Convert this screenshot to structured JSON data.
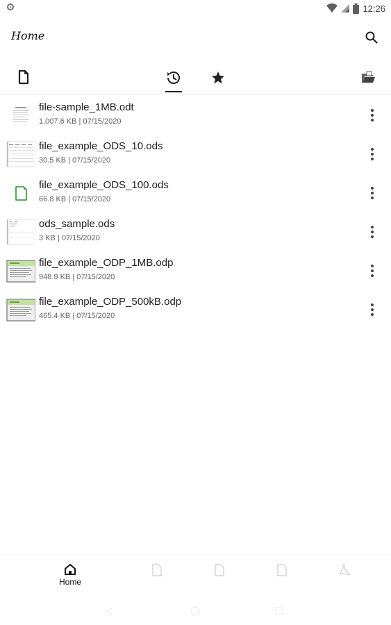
{
  "status_bar": {
    "time": "12:26"
  },
  "app_bar": {
    "title": "Home"
  },
  "tabs": [
    {
      "icon": "document-icon"
    },
    {
      "icon": "recent-history-icon",
      "selected": true
    },
    {
      "icon": "star-icon"
    },
    {
      "icon": "open-folder-icon"
    }
  ],
  "files": [
    {
      "name": "file-sample_1MB.odt",
      "meta": "1,007.6 KB | 07/15/2020",
      "thumb": "text-document-thumbnail"
    },
    {
      "name": "file_example_ODS_10.ods",
      "meta": "30.5 KB | 07/15/2020",
      "thumb": "spreadsheet-thumbnail"
    },
    {
      "name": "file_example_ODS_100.ods",
      "meta": "66.8 KB | 07/15/2020",
      "thumb": "spreadsheet-file-icon"
    },
    {
      "name": "ods_sample.ods",
      "meta": "3 KB | 07/15/2020",
      "thumb": "spreadsheet-thumbnail"
    },
    {
      "name": "file_example_ODP_1MB.odp",
      "meta": "948.9 KB | 07/15/2020",
      "thumb": "presentation-thumbnail"
    },
    {
      "name": "file_example_ODP_500kB.odp",
      "meta": "465.4 KB | 07/15/2020",
      "thumb": "presentation-thumbnail"
    }
  ],
  "bottom_nav": {
    "home_label": "Home"
  },
  "colors": {
    "spreadsheet_green": "#43a047",
    "presentation_green": "#c5e1a5"
  }
}
